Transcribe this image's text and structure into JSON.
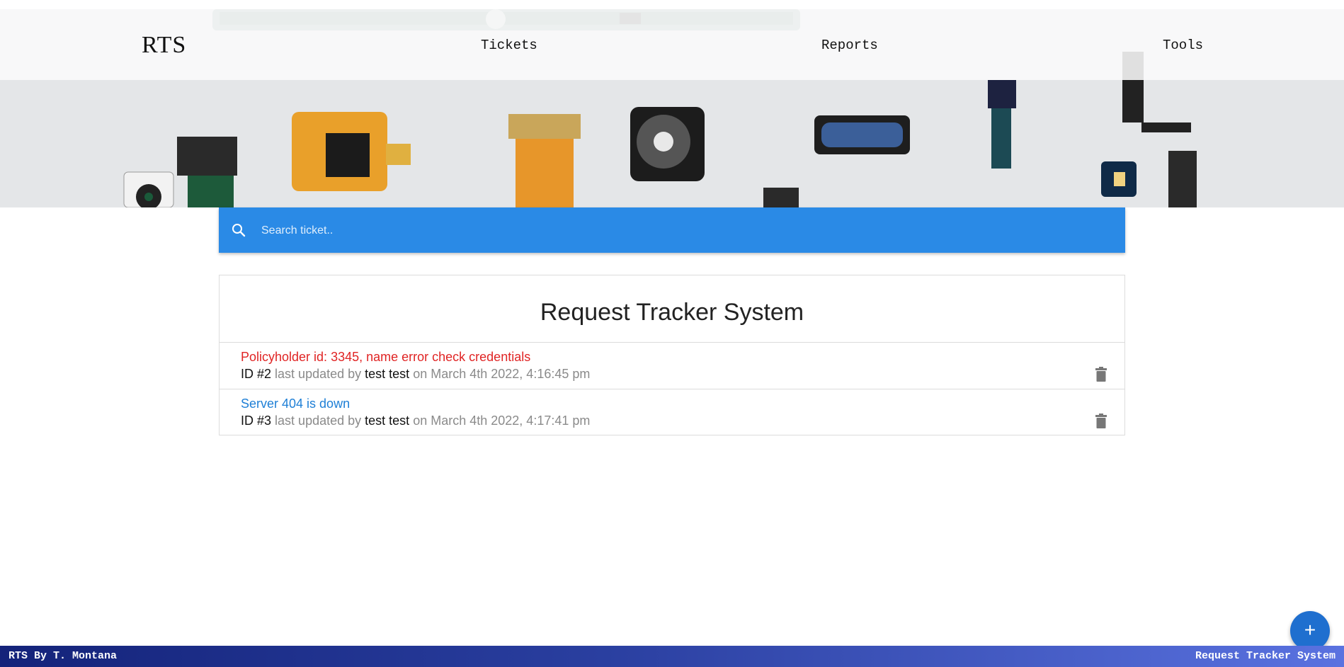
{
  "nav": {
    "brand": "RTS",
    "links": [
      "Tickets",
      "Reports",
      "Tools"
    ]
  },
  "search": {
    "placeholder": "Search ticket..",
    "icon": "search-icon"
  },
  "card": {
    "title": "Request Tracker System",
    "tickets": [
      {
        "title": "Policyholder id: 3345, name error check credentials",
        "title_color": "#e02424",
        "id_label": "ID #2",
        "updated_by_label": "last updated by",
        "user": "test test",
        "date": "on March 4th 2022, 4:16:45 pm",
        "action_icon": "trash-icon"
      },
      {
        "title": "Server 404 is down",
        "title_color": "#1e7fd6",
        "id_label": "ID #3",
        "updated_by_label": "last updated by",
        "user": "test test",
        "date": "on March 4th 2022, 4:17:41 pm",
        "action_icon": "trash-icon"
      }
    ]
  },
  "fab": {
    "label": "+",
    "icon": "plus-icon"
  },
  "footer": {
    "left": "RTS By T. Montana",
    "right": "Request Tracker System"
  },
  "colors": {
    "search_bar": "#2a8ae6",
    "fab": "#1f6fcf",
    "footer_start": "#14237a",
    "footer_end": "#5a72e0"
  }
}
